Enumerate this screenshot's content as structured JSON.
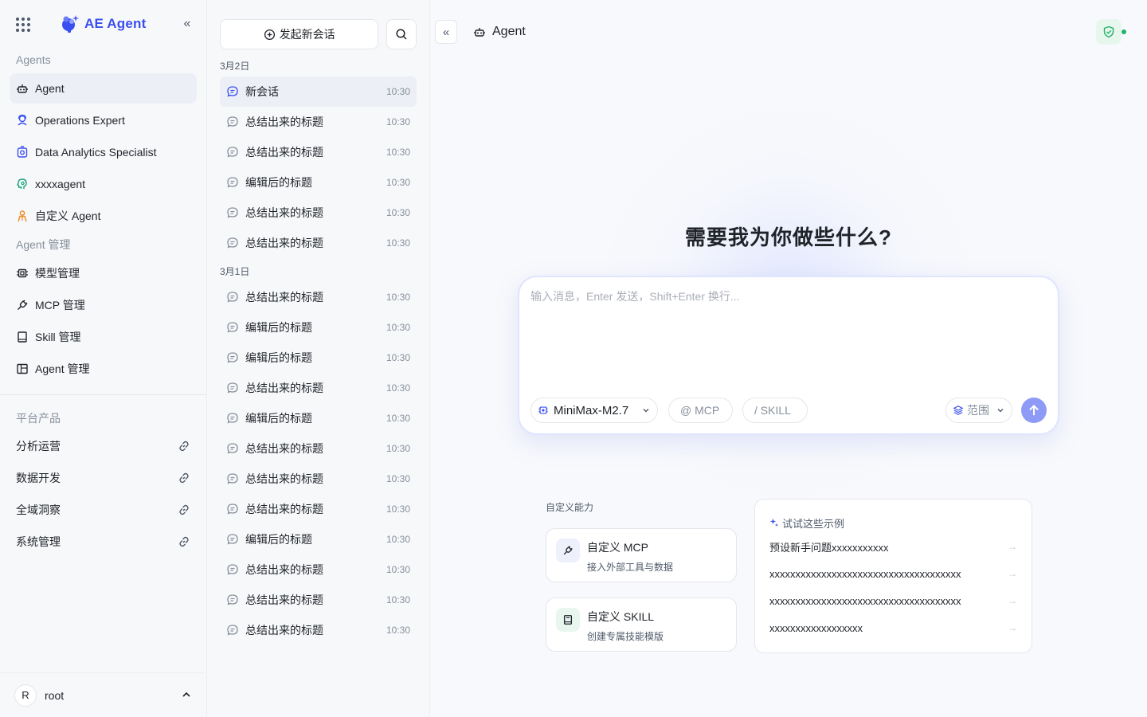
{
  "app": {
    "name": "AE Agent"
  },
  "nav": {
    "agents_title": "Agents",
    "agents": [
      {
        "label": "Agent",
        "icon": "robot-icon",
        "active": true
      },
      {
        "label": "Operations Expert",
        "icon": "operator-icon"
      },
      {
        "label": "Data Analytics Specialist",
        "icon": "analytics-icon"
      },
      {
        "label": "xxxxagent",
        "icon": "brain-icon"
      },
      {
        "label": "自定义 Agent",
        "icon": "person-icon"
      }
    ],
    "manage_title": "Agent 管理",
    "manage": [
      {
        "label": "模型管理",
        "icon": "chip-icon"
      },
      {
        "label": "MCP 管理",
        "icon": "plug-icon"
      },
      {
        "label": "Skill 管理",
        "icon": "book-icon"
      },
      {
        "label": "Agent 管理",
        "icon": "layout-icon"
      }
    ],
    "products_title": "平台产品",
    "products": [
      {
        "label": "分析运营"
      },
      {
        "label": "数据开发"
      },
      {
        "label": "全域洞察"
      },
      {
        "label": "系统管理"
      }
    ],
    "user": {
      "initial": "R",
      "name": "root"
    }
  },
  "sessions": {
    "new_label": "发起新会话",
    "groups": [
      {
        "date": "3月2日",
        "items": [
          {
            "title": "新会话",
            "time": "10:30",
            "active": true
          },
          {
            "title": "总结出来的标题",
            "time": "10:30"
          },
          {
            "title": "总结出来的标题",
            "time": "10:30"
          },
          {
            "title": "编辑后的标题",
            "time": "10:30"
          },
          {
            "title": "总结出来的标题",
            "time": "10:30"
          },
          {
            "title": "总结出来的标题",
            "time": "10:30"
          }
        ]
      },
      {
        "date": "3月1日",
        "items": [
          {
            "title": "总结出来的标题",
            "time": "10:30"
          },
          {
            "title": "编辑后的标题",
            "time": "10:30"
          },
          {
            "title": "编辑后的标题",
            "time": "10:30"
          },
          {
            "title": "总结出来的标题",
            "time": "10:30"
          },
          {
            "title": "编辑后的标题",
            "time": "10:30"
          },
          {
            "title": "总结出来的标题",
            "time": "10:30"
          },
          {
            "title": "总结出来的标题",
            "time": "10:30"
          },
          {
            "title": "总结出来的标题",
            "time": "10:30"
          },
          {
            "title": "编辑后的标题",
            "time": "10:30"
          },
          {
            "title": "总结出来的标题",
            "time": "10:30"
          },
          {
            "title": "总结出来的标题",
            "time": "10:30"
          },
          {
            "title": "总结出来的标题",
            "time": "10:30"
          }
        ]
      }
    ]
  },
  "main": {
    "agent_name": "Agent",
    "headline": "需要我为你做些什么?",
    "input_placeholder": "输入消息，Enter 发送，Shift+Enter 换行...",
    "model": "MiniMax-M2.7",
    "mcp_chip": "@ MCP",
    "skill_chip": "/ SKILL",
    "scope_label": "范围",
    "capabilities_title": "自定义能力",
    "capabilities": [
      {
        "title": "自定义 MCP",
        "desc": "接入外部工具与数据",
        "icon": "plug-icon"
      },
      {
        "title": "自定义 SKILL",
        "desc": "创建专属技能模版",
        "icon": "book-icon"
      }
    ],
    "examples_title": "试试这些示例",
    "examples": [
      "预设新手问题xxxxxxxxxxx",
      "xxxxxxxxxxxxxxxxxxxxxxxxxxxxxxxxxxxxx",
      "xxxxxxxxxxxxxxxxxxxxxxxxxxxxxxxxxxxxx",
      "xxxxxxxxxxxxxxxxxx"
    ]
  },
  "colors": {
    "brand": "#3a4ef0",
    "send": "#8d9bf6",
    "status": "#23b26b"
  }
}
